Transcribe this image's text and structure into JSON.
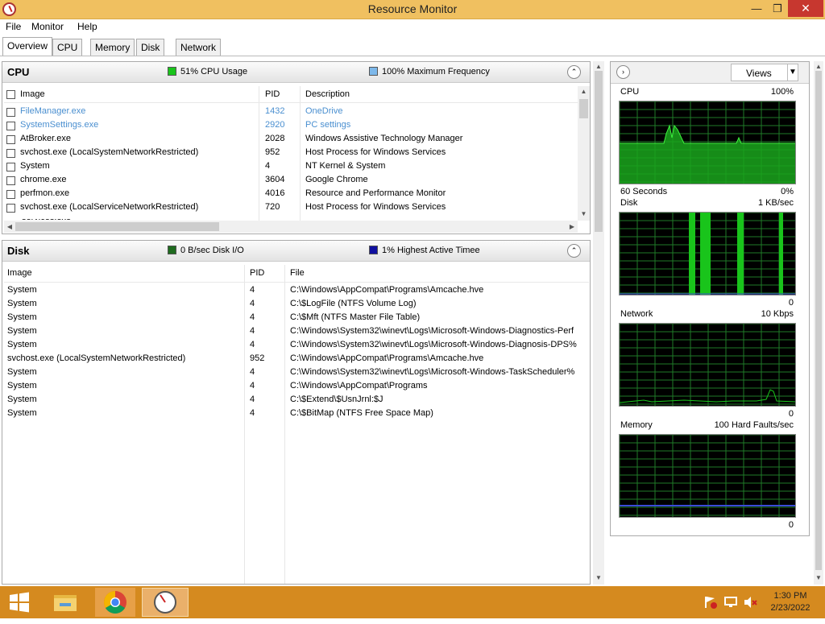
{
  "window": {
    "title": "Resource Monitor",
    "min_icon": "minimize-icon",
    "max_icon": "restore-icon",
    "close_icon": "close-icon"
  },
  "menu": [
    "File",
    "Monitor",
    "Help"
  ],
  "tabs": [
    "Overview",
    "CPU",
    "Memory",
    "Disk",
    "Network"
  ],
  "active_tab": "Overview",
  "cpu_panel": {
    "title": "CPU",
    "usage_label": "51% CPU Usage",
    "usage_color": "#19c41b",
    "freq_label": "100% Maximum Frequency",
    "freq_color": "#7db8ea",
    "columns": [
      "Image",
      "PID",
      "Description"
    ],
    "rows": [
      {
        "image": "FileManager.exe",
        "pid": "1432",
        "desc": "OneDrive",
        "link": true
      },
      {
        "image": "SystemSettings.exe",
        "pid": "2920",
        "desc": "PC settings",
        "link": true
      },
      {
        "image": "AtBroker.exe",
        "pid": "2028",
        "desc": "Windows Assistive Technology Manager",
        "link": false
      },
      {
        "image": "svchost.exe (LocalSystemNetworkRestricted)",
        "pid": "952",
        "desc": "Host Process for Windows Services",
        "link": false
      },
      {
        "image": "System",
        "pid": "4",
        "desc": "NT Kernel & System",
        "link": false
      },
      {
        "image": "chrome.exe",
        "pid": "3604",
        "desc": "Google Chrome",
        "link": false
      },
      {
        "image": "perfmon.exe",
        "pid": "4016",
        "desc": "Resource and Performance Monitor",
        "link": false
      },
      {
        "image": "svchost.exe (LocalServiceNetworkRestricted)",
        "pid": "720",
        "desc": "Host Process for Windows Services",
        "link": false
      }
    ]
  },
  "disk_panel": {
    "title": "Disk",
    "io_label": "0 B/sec Disk I/O",
    "io_color": "#1f6b1f",
    "active_label": "1% Highest Active Timee",
    "active_color": "#1010a0",
    "columns": [
      "Image",
      "PID",
      "File"
    ],
    "rows": [
      {
        "image": "System",
        "pid": "4",
        "file": "C:\\Windows\\AppCompat\\Programs\\Amcache.hve"
      },
      {
        "image": "System",
        "pid": "4",
        "file": "C:\\$LogFile (NTFS Volume Log)"
      },
      {
        "image": "System",
        "pid": "4",
        "file": "C:\\$Mft (NTFS Master File Table)"
      },
      {
        "image": "System",
        "pid": "4",
        "file": "C:\\Windows\\System32\\winevt\\Logs\\Microsoft-Windows-Diagnostics-Perf"
      },
      {
        "image": "System",
        "pid": "4",
        "file": "C:\\Windows\\System32\\winevt\\Logs\\Microsoft-Windows-Diagnosis-DPS%"
      },
      {
        "image": "svchost.exe (LocalSystemNetworkRestricted)",
        "pid": "952",
        "file": "C:\\Windows\\AppCompat\\Programs\\Amcache.hve"
      },
      {
        "image": "System",
        "pid": "4",
        "file": "C:\\Windows\\System32\\winevt\\Logs\\Microsoft-Windows-TaskScheduler%"
      },
      {
        "image": "System",
        "pid": "4",
        "file": "C:\\Windows\\AppCompat\\Programs"
      },
      {
        "image": "System",
        "pid": "4",
        "file": "C:\\$Extend\\$UsnJrnl:$J"
      },
      {
        "image": "System",
        "pid": "4",
        "file": "C:\\$BitMap (NTFS Free Space Map)"
      }
    ]
  },
  "side": {
    "views_label": "Views",
    "graphs": [
      {
        "name": "CPU",
        "max": "100%",
        "bottom_left": "60 Seconds",
        "bottom_right": "0%"
      },
      {
        "name": "Disk",
        "max": "1 KB/sec",
        "bottom_left": "",
        "bottom_right": "0"
      },
      {
        "name": "Network",
        "max": "10 Kbps",
        "bottom_left": "",
        "bottom_right": "0"
      },
      {
        "name": "Memory",
        "max": "100 Hard Faults/sec",
        "bottom_left": "",
        "bottom_right": "0"
      }
    ]
  },
  "taskbar": {
    "time": "1:30 PM",
    "date": "2/23/2022",
    "icons": [
      "windows-start-icon",
      "file-explorer-icon",
      "chrome-icon",
      "resource-monitor-icon",
      "action-center-flag-icon",
      "network-icon",
      "volume-muted-icon"
    ]
  }
}
